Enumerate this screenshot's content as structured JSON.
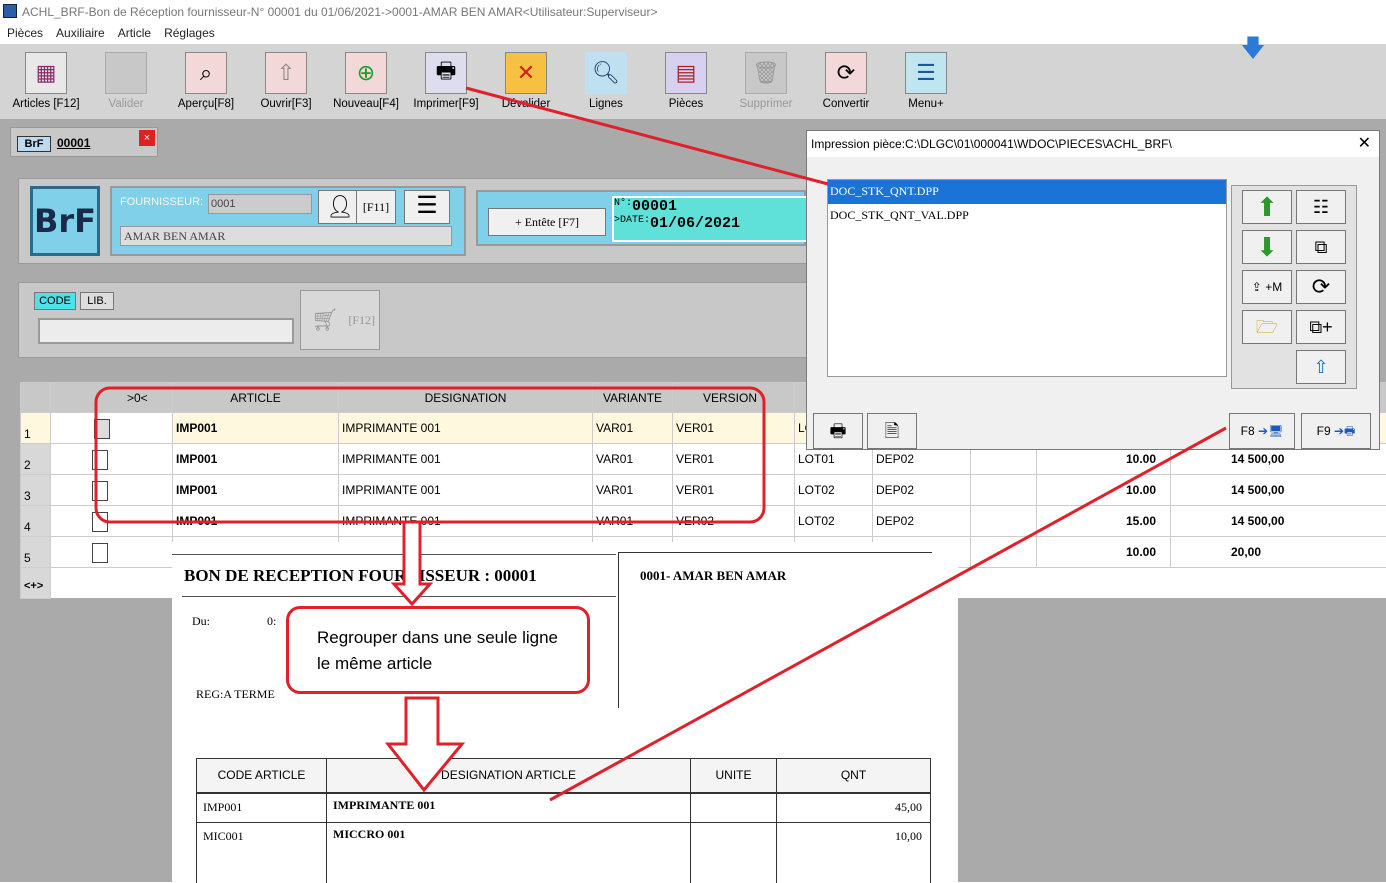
{
  "window": {
    "title": "ACHL_BRF-Bon de Réception fournisseur-N° 00001 du 01/06/2021->0001-AMAR BEN AMAR<Utilisateur:Superviseur>"
  },
  "menubar": [
    "Pièces",
    "Auxiliaire",
    "Article",
    "Réglages"
  ],
  "toolbar": [
    {
      "label": "Articles [F12]",
      "icon": "grid-icon",
      "enabled": true
    },
    {
      "label": "Valider",
      "icon": "validate-icon",
      "enabled": false
    },
    {
      "label": "Aperçu[F8]",
      "icon": "preview-icon",
      "enabled": true
    },
    {
      "label": "Ouvrir[F3]",
      "icon": "open-icon",
      "enabled": true
    },
    {
      "label": "Nouveau[F4]",
      "icon": "new-icon",
      "enabled": true
    },
    {
      "label": "Imprimer[F9]",
      "icon": "printer-icon",
      "enabled": true
    },
    {
      "label": "Dévalider",
      "icon": "invalidate-icon",
      "enabled": true
    },
    {
      "label": "Lignes",
      "icon": "magnifier-icon",
      "enabled": true
    },
    {
      "label": "Pièces",
      "icon": "documents-icon",
      "enabled": true
    },
    {
      "label": "Supprimer",
      "icon": "trash-icon",
      "enabled": false
    },
    {
      "label": "Convertir",
      "icon": "convert-icon",
      "enabled": true
    },
    {
      "label": "Menu+",
      "icon": "menu-icon",
      "enabled": true
    }
  ],
  "doc_tab": {
    "tag": "BrF",
    "number": "00001",
    "close": "×"
  },
  "header": {
    "logo": "BrF",
    "supplier_label": "FOURNISSEUR:",
    "supplier_code": "0001",
    "supplier_name": "AMAR BEN AMAR",
    "f11": "[F11]",
    "entete_label": "Entête [F7]",
    "number_label": "N°:",
    "number": "00001",
    "date_label": ">DATE:",
    "date": "01/06/2021"
  },
  "search": {
    "code_tab": "CODE",
    "lib_tab": "LIB.",
    "cart_label": "[F12]"
  },
  "grid": {
    "columns": [
      "",
      ">0<",
      "ARTICLE",
      "DESIGNATION",
      "VARIANTE",
      "VERSION",
      "",
      "",
      "",
      "",
      ""
    ],
    "rows": [
      {
        "n": "1",
        "article": "IMP001",
        "designation": "IMPRIMANTE 001",
        "variante": "VAR01",
        "version": "VER01",
        "lot": "LO",
        "depot": "",
        "qty": "",
        "price": ""
      },
      {
        "n": "2",
        "article": "IMP001",
        "designation": "IMPRIMANTE 001",
        "variante": "VAR01",
        "version": "VER01",
        "lot": "LOT01",
        "depot": "DEP02",
        "qty": "10.00",
        "price": "14 500,00"
      },
      {
        "n": "3",
        "article": "IMP001",
        "designation": "IMPRIMANTE 001",
        "variante": "VAR01",
        "version": "VER01",
        "lot": "LOT02",
        "depot": "DEP02",
        "qty": "10.00",
        "price": "14 500,00"
      },
      {
        "n": "4",
        "article": "IMP001",
        "designation": "IMPRIMANTE 001",
        "variante": "VAR01",
        "version": "VER02",
        "lot": "LOT02",
        "depot": "DEP02",
        "qty": "15.00",
        "price": "14 500,00"
      },
      {
        "n": "5",
        "article": "",
        "designation": "",
        "variante": "",
        "version": "",
        "lot": "",
        "depot": "",
        "qty": "10.00",
        "price": "20,00"
      }
    ],
    "footer": "<+>"
  },
  "dialog": {
    "title": "Impression pièce:C:\\DLGC\\01\\000041\\WDOC\\PIECES\\ACHL_BRF\\",
    "close": "✕",
    "files": [
      "DOC_STK_QNT.DPP",
      "DOC_STK_QNT_VAL.DPP"
    ],
    "selected": 0,
    "add_m_label": "+M",
    "f8_label": "F8",
    "f9_label": "F9"
  },
  "report": {
    "title": "BON DE RECEPTION FOURNISSEUR : 00001",
    "supplier": "0001- AMAR BEN AMAR",
    "du_label": "Du:",
    "du_value": "0:",
    "reg": "REG:A TERME",
    "columns": [
      "CODE ARTICLE",
      "DESIGNATION ARTICLE",
      "UNITE",
      "QNT"
    ],
    "rows": [
      {
        "code": "IMP001",
        "designation": "IMPRIMANTE 001",
        "unite": "",
        "qnt": "45,00"
      },
      {
        "code": "MIC001",
        "designation": "MICCRO 001",
        "unite": "",
        "qnt": "10,00"
      }
    ]
  },
  "annotation": {
    "note": "Regrouper dans une seule ligne le même article",
    "color": "#e0202a"
  }
}
